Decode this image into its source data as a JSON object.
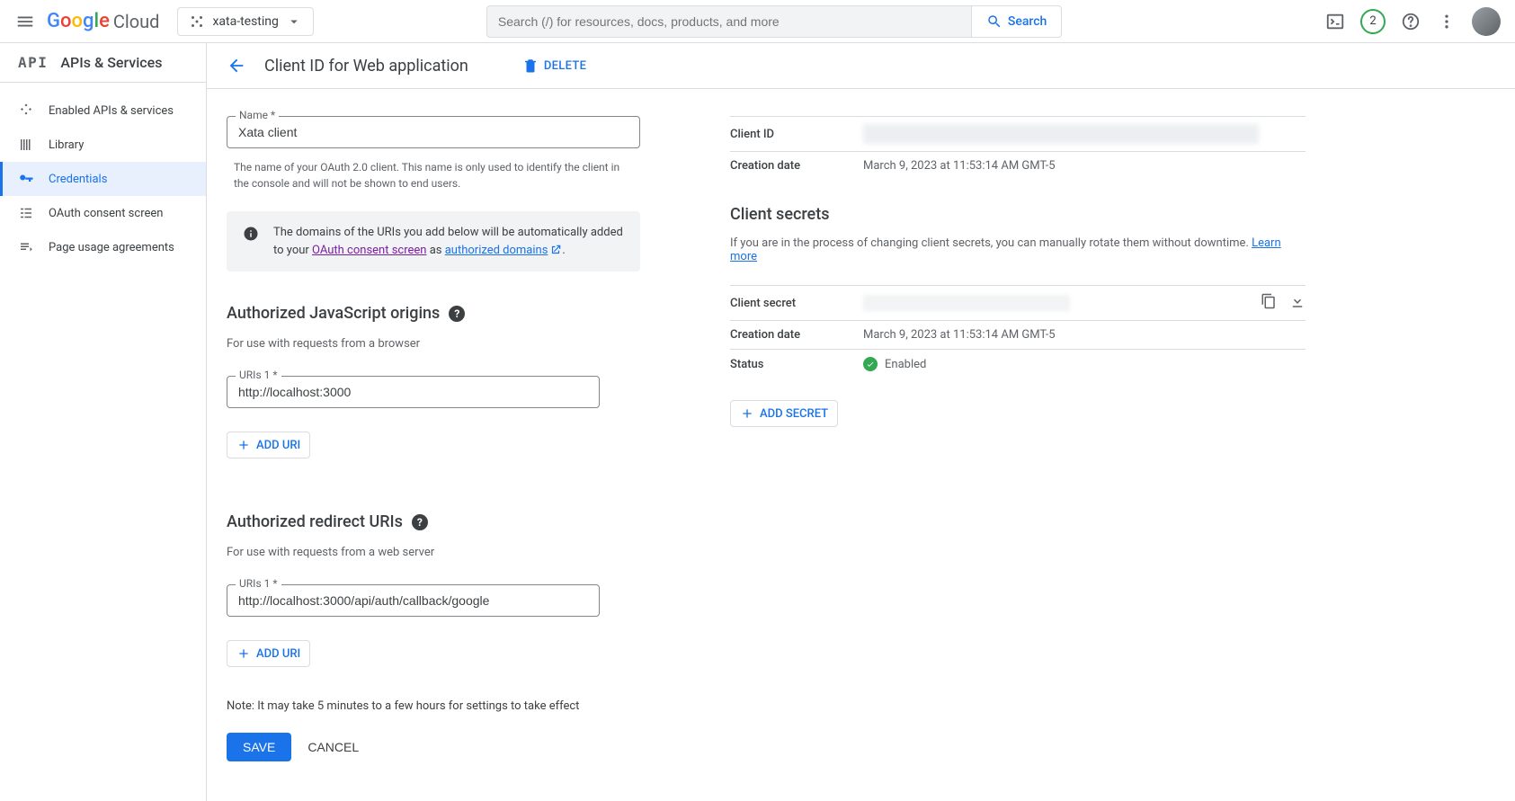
{
  "header": {
    "logo_text": "Google Cloud",
    "project": "xata-testing",
    "search_placeholder": "Search (/) for resources, docs, products, and more",
    "search_label": "Search",
    "badge": "2"
  },
  "sidebar": {
    "title": "APIs & Services",
    "logo": "API",
    "items": [
      {
        "label": "Enabled APIs & services"
      },
      {
        "label": "Library"
      },
      {
        "label": "Credentials"
      },
      {
        "label": "OAuth consent screen"
      },
      {
        "label": "Page usage agreements"
      }
    ]
  },
  "page": {
    "title": "Client ID for Web application",
    "delete": "DELETE",
    "name_label": "Name *",
    "name_value": "Xata client",
    "name_helper": "The name of your OAuth 2.0 client. This name is only used to identify the client in the console and will not be shown to end users.",
    "info_prefix": "The domains of the URIs you add below will be automatically added to your ",
    "info_link1": "OAuth consent screen",
    "info_mid": " as ",
    "info_link2": "authorized domains",
    "js_origins_h": "Authorized JavaScript origins",
    "js_origins_sub": "For use with requests from a browser",
    "uri1_label": "URIs 1 *",
    "uri1_value": "http://localhost:3000",
    "redirect_h": "Authorized redirect URIs",
    "redirect_sub": "For use with requests from a web server",
    "uri2_label": "URIs 1 *",
    "uri2_value": "http://localhost:3000/api/auth/callback/google",
    "add_uri": "ADD URI",
    "note": "Note: It may take 5 minutes to a few hours for settings to take effect",
    "save": "SAVE",
    "cancel": "CANCEL"
  },
  "info": {
    "client_id": "Client ID",
    "creation_date": "Creation date",
    "creation_value": "March 9, 2023 at 11:53:14 AM GMT-5",
    "secrets_h": "Client secrets",
    "secrets_sub": "If you are in the process of changing client secrets, you can manually rotate them without downtime. ",
    "learn_more": "Learn more",
    "client_secret": "Client secret",
    "status": "Status",
    "status_value": "Enabled",
    "add_secret": "ADD SECRET"
  }
}
